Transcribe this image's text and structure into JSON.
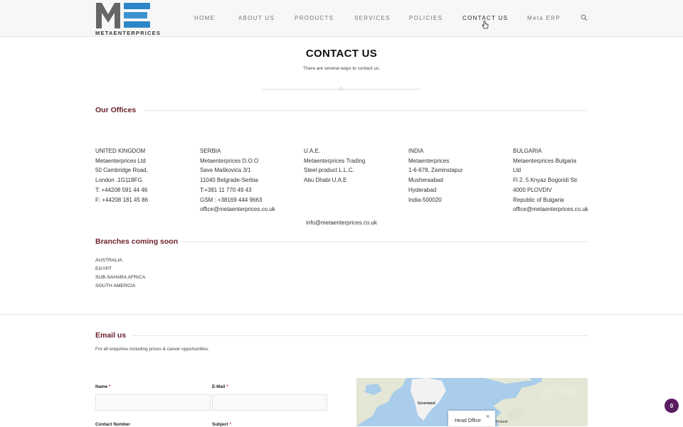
{
  "brand": {
    "logo_text": "METAENTERPRICES",
    "colors": {
      "primary_dark": "#5a5a5a",
      "accent_blue": "#2d86c7",
      "heading": "#6b1d2b",
      "badge": "#5b1d62"
    }
  },
  "nav": {
    "items": [
      {
        "label": "HOME"
      },
      {
        "label": "ABOUT US"
      },
      {
        "label": "PRODUCTS"
      },
      {
        "label": "SERVICES"
      },
      {
        "label": "POLICIES"
      },
      {
        "label": "CONTACT US"
      },
      {
        "label": "Meta ERP"
      }
    ],
    "active": "CONTACT US",
    "search_icon": "search-icon"
  },
  "page": {
    "title": "CONTACT US",
    "subtitle": "There are several ways to contact us."
  },
  "offices": {
    "heading": "Our Offices",
    "list": [
      {
        "lines": [
          "UNITED KINGDOM",
          "Metaenterprices Ltd",
          "50 Cambridge Road,",
          "London .1G118FG.",
          "T: +44208 591 44 46",
          "F: +44208 181 45 86"
        ]
      },
      {
        "lines": [
          "SERBIA",
          "Metaenterprices D.O.O",
          "Save Maškovića 3/1",
          "11040 Belgrade-Serbia",
          "T:+381 11 770 49 43",
          "GSM : +38169 444 9663",
          "office@metaenterprices.co.uk"
        ]
      },
      {
        "lines": [
          "U.A.E.",
          "Metaenterprices Trading",
          "Steel product L.L.C.",
          "Abu Dhabi U.A.E"
        ]
      },
      {
        "lines": [
          "INDIA",
          "Metaenterprices",
          "1-6-678, Zaminstapur",
          "Musheraabad",
          "Hyderabad",
          "India-500020"
        ]
      },
      {
        "lines": [
          "BULGARIA",
          "Metaenterprices Bulgaria",
          "Ltd",
          "Fl 2. 5 Knyaz Bogoridi Str.",
          "4000 PLOVDIV",
          "Republic of Bulgaria",
          "office@metaenterprices.co.uk"
        ]
      }
    ],
    "info_email": "info@metaenterprices.co.uk"
  },
  "branches": {
    "heading": "Branches coming soon",
    "list": [
      "AUSTRALIA",
      "EGYPT",
      "SUB-SAHARA AFRICA",
      "SOUTH AMERCIA"
    ]
  },
  "email_section": {
    "heading": "Email us",
    "subtitle": "For all enquiries including prices & career opportunities.",
    "form": {
      "name_label": "Name",
      "email_label": "E-Mail",
      "contact_label": "Contact Number",
      "subject_label": "Subject",
      "required_mark": "*",
      "name_value": "",
      "email_value": ""
    }
  },
  "map": {
    "labels": {
      "greenland": "Greenland",
      "finland": "Finland"
    },
    "popup_text": "Head Office",
    "close_glyph": "×"
  },
  "badge": {
    "count": "0"
  }
}
